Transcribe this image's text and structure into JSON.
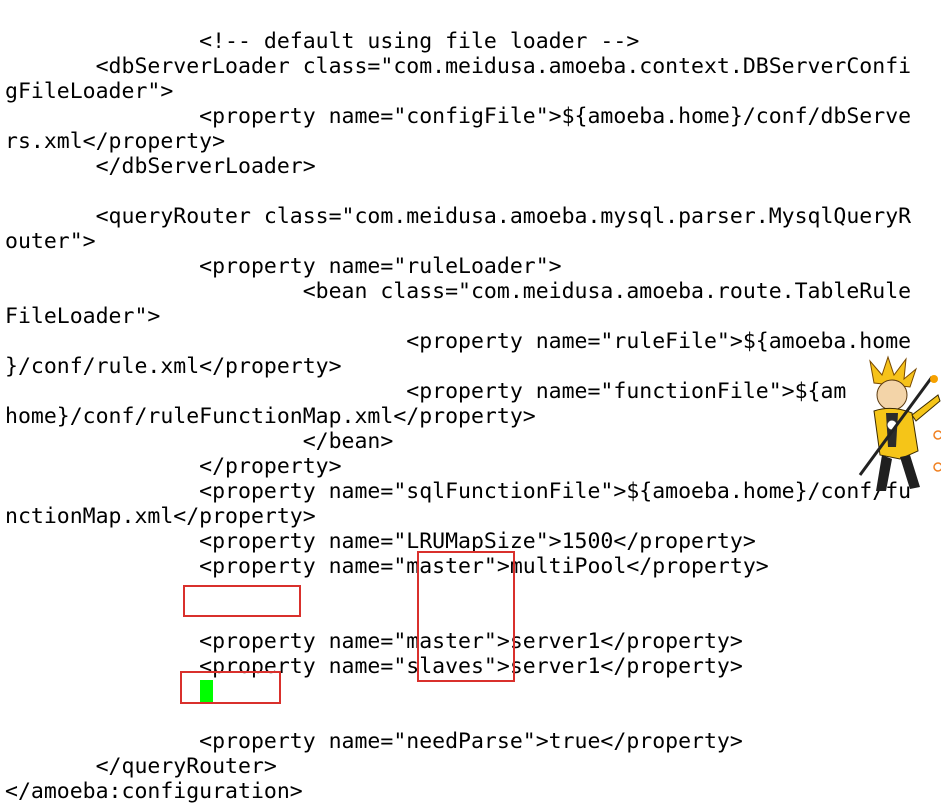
{
  "editor": {
    "lines": [
      "",
      "               <!-- default using file loader -->",
      "       <dbServerLoader class=\"com.meidusa.amoeba.context.DBServerConfi",
      "gFileLoader\">",
      "               <property name=\"configFile\">${amoeba.home}/conf/dbServe",
      "rs.xml</property>",
      "       </dbServerLoader>",
      "",
      "       <queryRouter class=\"com.meidusa.amoeba.mysql.parser.MysqlQueryR",
      "outer\">",
      "               <property name=\"ruleLoader\">",
      "                       <bean class=\"com.meidusa.amoeba.route.TableRule",
      "FileLoader\">",
      "                               <property name=\"ruleFile\">${amoeba.home",
      "}/conf/rule.xml</property>",
      "                               <property name=\"functionFile\">${am",
      "home}/conf/ruleFunctionMap.xml</property>",
      "                       </bean>",
      "               </property>",
      "               <property name=\"sqlFunctionFile\">${amoeba.home}/conf/fu",
      "nctionMap.xml</property>",
      "               <property name=\"LRUMapSize\">1500</property>",
      "               <property name=\"master\">multiPool</property>",
      "",
      "",
      "               <property name=\"master\">server1</property>",
      "               <property name=\"slaves\">server1</property>",
      "",
      "",
      "               <property name=\"needParse\">true</property>",
      "       </queryRouter>",
      "</amoeba:configuration>"
    ]
  },
  "colors": {
    "text": "#000000",
    "background": "#ffffff",
    "highlight_box": "#d9302c",
    "cursor": "#00ff00"
  }
}
